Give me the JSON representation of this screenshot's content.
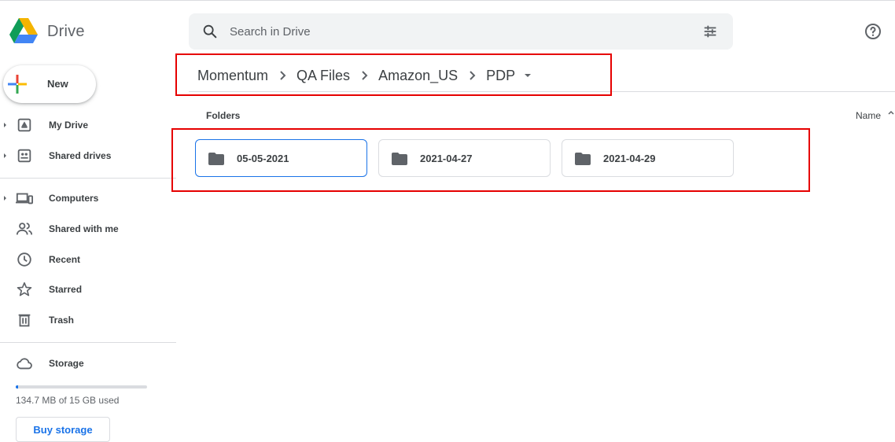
{
  "header": {
    "app_title": "Drive",
    "search_placeholder": "Search in Drive",
    "icons": [
      "drive-logo",
      "search-icon",
      "search-options-icon",
      "help-icon"
    ]
  },
  "sidebar": {
    "new_label": "New",
    "items": [
      {
        "label": "My Drive",
        "icon": "my-drive-icon"
      },
      {
        "label": "Shared drives",
        "icon": "shared-drives-icon"
      },
      {
        "label": "Computers",
        "icon": "computers-icon"
      },
      {
        "label": "Shared with me",
        "icon": "shared-with-me-icon"
      },
      {
        "label": "Recent",
        "icon": "recent-icon"
      },
      {
        "label": "Starred",
        "icon": "starred-icon"
      },
      {
        "label": "Trash",
        "icon": "trash-icon"
      },
      {
        "label": "Storage",
        "icon": "storage-icon"
      }
    ],
    "storage_used_text": "134.7 MB of 15 GB used",
    "storage_fraction": 0.009,
    "buy_storage_label": "Buy storage"
  },
  "breadcrumb": [
    "Momentum",
    "QA Files",
    "Amazon_US",
    "PDP"
  ],
  "main": {
    "section_title": "Folders",
    "sort_label": "Name",
    "folders": [
      {
        "name": "05-05-2021",
        "selected": true
      },
      {
        "name": "2021-04-27",
        "selected": false
      },
      {
        "name": "2021-04-29",
        "selected": false
      }
    ]
  },
  "colors": {
    "accent": "#1a73e8",
    "annotation": "#e60000",
    "drive_green": "#0f9d58",
    "drive_yellow": "#f4b400",
    "drive_blue": "#4285f4"
  }
}
